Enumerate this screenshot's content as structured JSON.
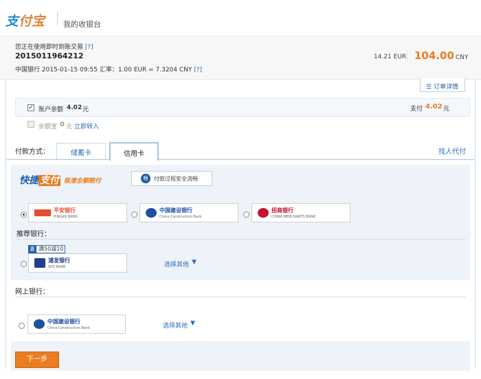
{
  "header": {
    "logo_text_a": "支",
    "logo_text_b": "付宝",
    "title": "我的收银台"
  },
  "order": {
    "using_text": "您正在使用即时到账交易",
    "help_mark": "[?]",
    "order_no": "2015011964212",
    "meta_text": "中国银行  2015-01-15 09:55 汇率：1.00 EUR = 7.3204 CNY",
    "meta_help": "[?]",
    "amount_eur": "14.21 EUR",
    "amount_cny": "104.00",
    "amount_cny_unit": "CNY"
  },
  "order_detail_button": {
    "icon": "list-icon",
    "label": "订单详情"
  },
  "balance": {
    "checked_mark": "✓",
    "label": "账户余额",
    "value": "4.02",
    "unit": "元",
    "pay_label": "支付",
    "pay_value": "4.02",
    "pay_unit": "元"
  },
  "yuebao": {
    "label": "余额宝",
    "value": "0",
    "unit": "元",
    "link": "立即转入"
  },
  "payment": {
    "method_label": "付款方式：",
    "tabs": [
      {
        "label": "储蓄卡",
        "active": false
      },
      {
        "label": "信用卡",
        "active": true
      }
    ],
    "find_pay_link": "找人代付"
  },
  "express": {
    "logo_a": "快捷",
    "logo_b": "支付",
    "sub": "极速全额赔付",
    "safety_icon_text": "畅",
    "safety_label": "付款过程安全流畅",
    "banks": [
      {
        "id": "pingan",
        "name": "平安银行",
        "en": "PINGAN BANK",
        "selected": true
      },
      {
        "id": "ccb",
        "name": "中国建设银行",
        "en": "China Construction Bank",
        "selected": false
      },
      {
        "id": "cmb",
        "name": "招商银行",
        "en": "CHINA MERCHANTS BANK",
        "selected": false
      }
    ],
    "recommend_label": "推荐银行：",
    "promo_icon": "惠",
    "promo_text": "满50减10",
    "recommended_bank": {
      "name": "浦发银行",
      "en": "SPD BANK"
    },
    "more_label": "选择其他",
    "more_arrow": "▼"
  },
  "online": {
    "label": "网上银行：",
    "bank": {
      "name": "中国建设银行",
      "en": "China Construction Bank"
    },
    "more_label": "选择其他",
    "more_arrow": "▼"
  },
  "next_button": "下一步",
  "colors": {
    "accent_orange": "#e97d20",
    "link_blue": "#2a6fb8",
    "brand_blue": "#1d5fa9",
    "panel_bg": "#eef2f9"
  }
}
